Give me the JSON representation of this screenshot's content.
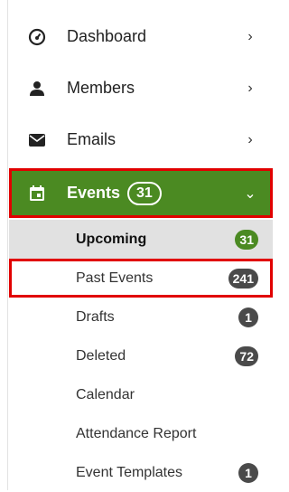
{
  "menu": {
    "dashboard": {
      "label": "Dashboard",
      "icon": "gauge-icon"
    },
    "members": {
      "label": "Members",
      "icon": "person-icon"
    },
    "emails": {
      "label": "Emails",
      "icon": "envelope-icon"
    },
    "events": {
      "label": "Events",
      "count": "31",
      "icon": "calendar-icon"
    }
  },
  "events_submenu": [
    {
      "label": "Upcoming",
      "badge": "31"
    },
    {
      "label": "Past Events",
      "badge": "241"
    },
    {
      "label": "Drafts",
      "badge": "1"
    },
    {
      "label": "Deleted",
      "badge": "72"
    },
    {
      "label": "Calendar"
    },
    {
      "label": "Attendance Report"
    },
    {
      "label": "Event Templates",
      "badge": "1"
    }
  ],
  "colors": {
    "accent_green": "#4b8a22",
    "highlight_red": "#e10000",
    "badge_dark": "#4a4a4a",
    "selected_bg": "#e1e1e1"
  }
}
